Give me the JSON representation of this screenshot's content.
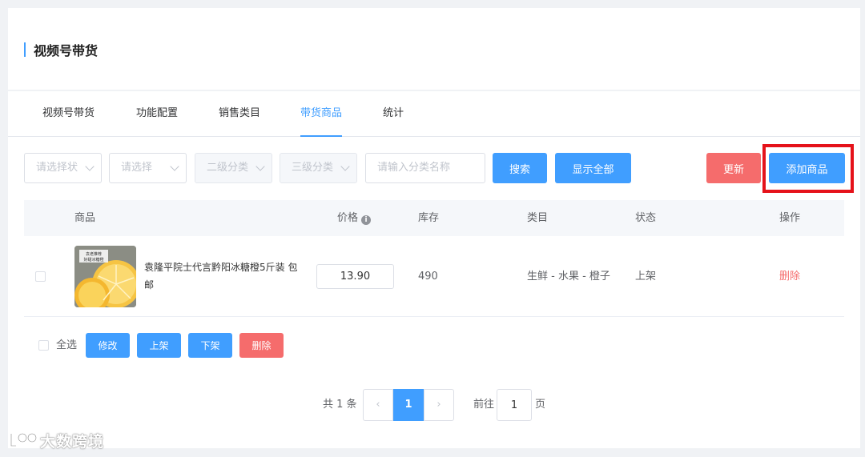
{
  "page": {
    "title": "视频号带货"
  },
  "tabs": [
    {
      "label": "视频号带货",
      "active": false
    },
    {
      "label": "功能配置",
      "active": false
    },
    {
      "label": "销售类目",
      "active": false
    },
    {
      "label": "带货商品",
      "active": true
    },
    {
      "label": "统计",
      "active": false
    }
  ],
  "filters": {
    "status_placeholder": "请选择状",
    "select_placeholder": "请选择",
    "level2_placeholder": "二级分类",
    "level3_placeholder": "三级分类",
    "category_name_placeholder": "请输入分类名称",
    "search_label": "搜索",
    "show_all_label": "显示全部",
    "refresh_label": "更新",
    "add_product_label": "添加商品"
  },
  "table": {
    "headers": {
      "product": "商品",
      "price": "价格",
      "stock": "库存",
      "category": "类目",
      "status": "状态",
      "actions": "操作"
    },
    "rows": [
      {
        "name": "袁隆平院士代言黔阳冰糖橙5斤装 包邮",
        "thumb_text": "袁老推荐 好甜冰糖橙",
        "price": "13.90",
        "stock": "490",
        "category": "生鲜 - 水果 - 橙子",
        "status": "上架",
        "action": "删除"
      }
    ]
  },
  "bulk": {
    "select_all_label": "全选",
    "edit_label": "修改",
    "online_label": "上架",
    "offline_label": "下架",
    "delete_label": "删除"
  },
  "pagination": {
    "total_text": "共 1 条",
    "current_page": "1",
    "goto_label": "前往",
    "goto_value": "1",
    "page_suffix": "页"
  },
  "watermark": {
    "text": "大数跨境"
  },
  "colors": {
    "primary": "#409eff",
    "danger": "#f56c6c",
    "highlight": "#e5121a"
  }
}
